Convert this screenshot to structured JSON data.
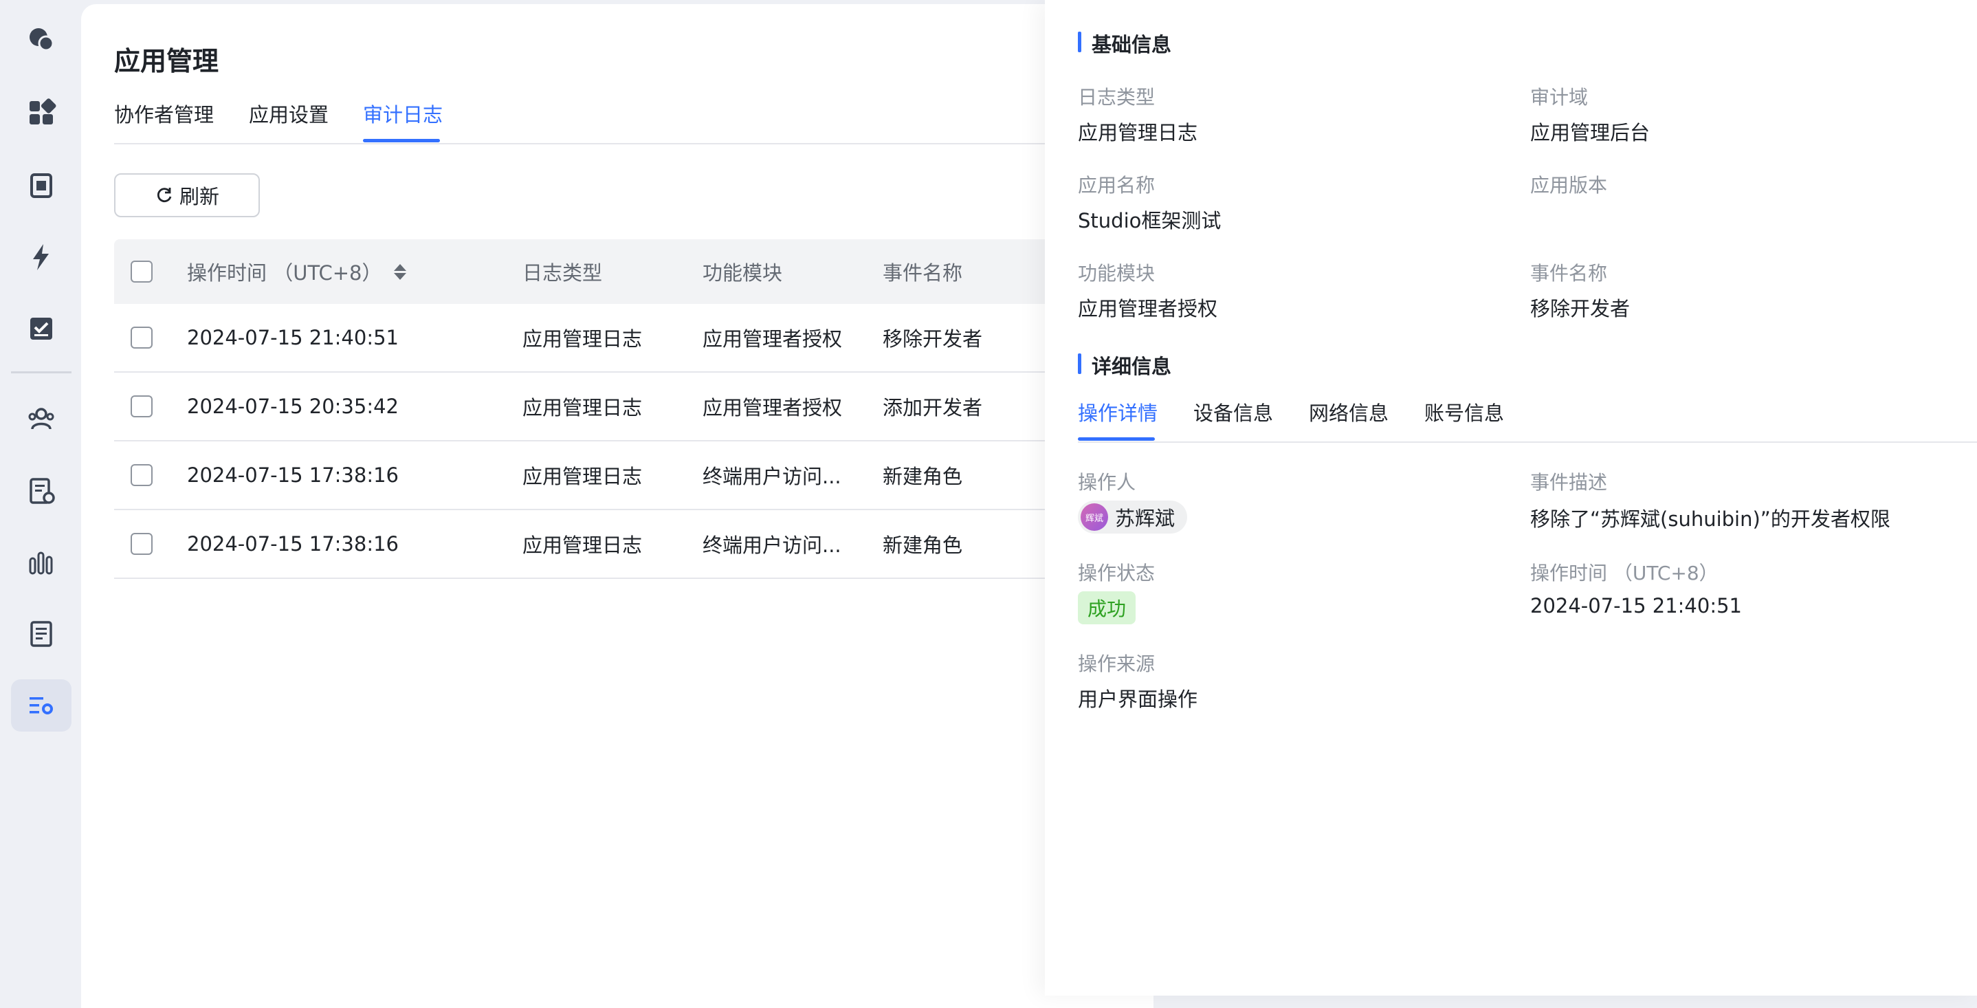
{
  "app": {
    "page_title": "应用管理"
  },
  "tabs": [
    {
      "label": "协作者管理"
    },
    {
      "label": "应用设置"
    },
    {
      "label": "审计日志",
      "active": true
    }
  ],
  "toolbar": {
    "refresh_label": "刷新"
  },
  "table": {
    "columns": [
      "操作时间 （UTC+8）",
      "日志类型",
      "功能模块",
      "事件名称"
    ],
    "rows": [
      {
        "time": "2024-07-15 21:40:51",
        "log_type": "应用管理日志",
        "module": "应用管理者授权",
        "event": "移除开发者"
      },
      {
        "time": "2024-07-15 20:35:42",
        "log_type": "应用管理日志",
        "module": "应用管理者授权",
        "event": "添加开发者"
      },
      {
        "time": "2024-07-15 17:38:16",
        "log_type": "应用管理日志",
        "module": "终端用户访问...",
        "event": "新建角色"
      },
      {
        "time": "2024-07-15 17:38:16",
        "log_type": "应用管理日志",
        "module": "终端用户访问...",
        "event": "新建角色"
      }
    ]
  },
  "drawer": {
    "basic_title": "基础信息",
    "basic": {
      "log_type_label": "日志类型",
      "log_type": "应用管理日志",
      "audit_domain_label": "审计域",
      "audit_domain": "应用管理后台",
      "app_name_label": "应用名称",
      "app_name": "Studio框架测试",
      "app_version_label": "应用版本",
      "app_version": "",
      "module_label": "功能模块",
      "module": "应用管理者授权",
      "event_label": "事件名称",
      "event": "移除开发者"
    },
    "detail_title": "详细信息",
    "detail_tabs": [
      {
        "label": "操作详情",
        "active": true
      },
      {
        "label": "设备信息"
      },
      {
        "label": "网络信息"
      },
      {
        "label": "账号信息"
      }
    ],
    "detail": {
      "operator_label": "操作人",
      "operator_avatar_text": "辉斌",
      "operator": "苏辉斌",
      "event_desc_label": "事件描述",
      "event_desc": "移除了“苏辉斌(suhuibin)”的开发者权限",
      "status_label": "操作状态",
      "status": "成功",
      "op_time_label": "操作时间 （UTC+8）",
      "op_time": "2024-07-15 21:40:51",
      "source_label": "操作来源",
      "source": "用户界面操作"
    }
  },
  "colors": {
    "accent": "#3370ff",
    "success_bg": "#d9f5d6",
    "success_text": "#2ea121",
    "icon": "#3c4554"
  }
}
